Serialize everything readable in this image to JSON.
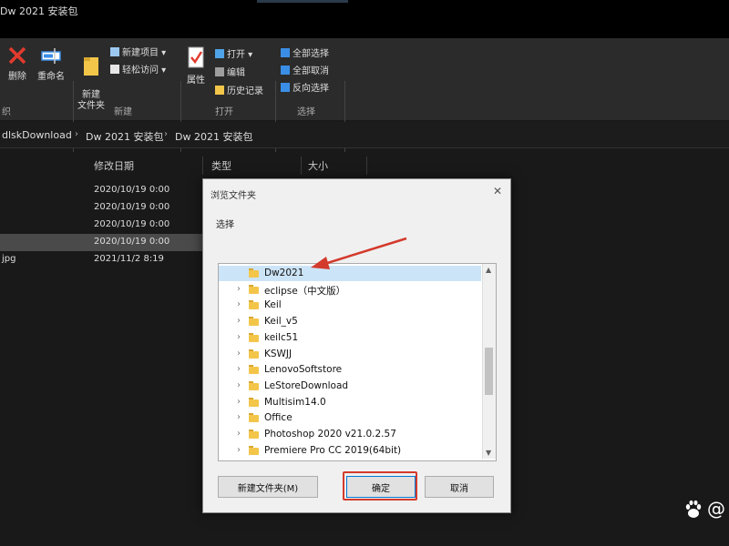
{
  "window": {
    "title": "Dw 2021 安装包"
  },
  "ribbon": {
    "delete_label": "删除",
    "rename_label": "重命名",
    "new_folder_label": "新建\n文件夹",
    "new_item_label": "新建项目 ▾",
    "easy_access_label": "轻松访问 ▾",
    "properties_label": "属性",
    "open_label": "打开 ▾",
    "edit_label": "编辑",
    "history_label": "历史记录",
    "select_all_label": "全部选择",
    "select_none_label": "全部取消",
    "invert_label": "反向选择",
    "group_organize": "织",
    "group_new": "新建",
    "group_open": "打开",
    "group_select": "选择"
  },
  "address": {
    "crumbs": [
      "dlskDownload",
      "Dw 2021 安装包",
      "Dw 2021 安装包"
    ]
  },
  "filelist": {
    "headers": {
      "date": "修改日期",
      "type": "类型",
      "size": "大小"
    },
    "rows": [
      {
        "name": "",
        "date": "2020/10/19 0:00"
      },
      {
        "name": "",
        "date": "2020/10/19 0:00"
      },
      {
        "name": "",
        "date": "2020/10/19 0:00"
      },
      {
        "name": "",
        "date": "2020/10/19 0:00"
      },
      {
        "name": "jpg",
        "date": "2021/11/2 8:19"
      }
    ]
  },
  "dialog": {
    "title": "浏览文件夹",
    "close": "✕",
    "prompt": "选择",
    "tree": [
      {
        "label": "Dw2021",
        "selected": true,
        "has_children": false
      },
      {
        "label": "eclipse（中文版）",
        "has_children": true
      },
      {
        "label": "Keil",
        "has_children": true
      },
      {
        "label": "Keil_v5",
        "has_children": true
      },
      {
        "label": "keilc51",
        "has_children": true
      },
      {
        "label": "KSWJJ",
        "has_children": true
      },
      {
        "label": "LenovoSoftstore",
        "has_children": true
      },
      {
        "label": "LeStoreDownload",
        "has_children": true
      },
      {
        "label": "Multisim14.0",
        "has_children": true
      },
      {
        "label": "Office",
        "has_children": true
      },
      {
        "label": "Photoshop 2020 v21.0.2.57",
        "has_children": true
      },
      {
        "label": "Premiere Pro CC 2019(64bit)",
        "has_children": true
      }
    ],
    "new_folder_button": "新建文件夹(M)",
    "ok_button": "确定",
    "cancel_button": "取消"
  },
  "watermark": {
    "text": "@"
  },
  "colors": {
    "annotation_red": "#d33a2c",
    "selection_blue": "#cce4f7",
    "folder_yellow": "#f3c64a"
  }
}
